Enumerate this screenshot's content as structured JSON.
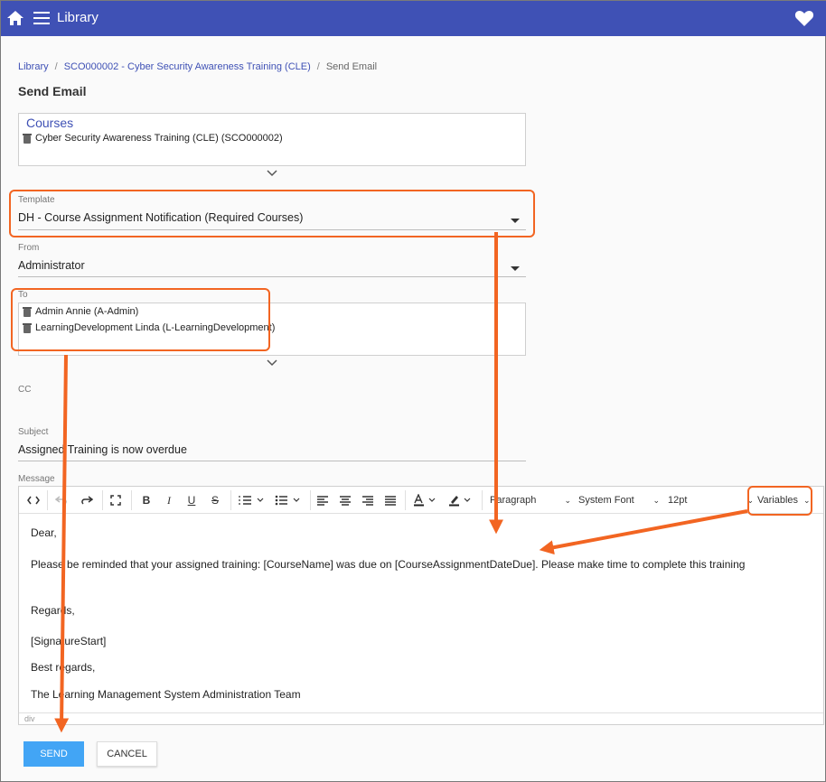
{
  "app": {
    "title": "Library"
  },
  "breadcrumb": [
    "Library",
    "SCO000002 - Cyber Security Awareness Training (CLE)",
    "Send Email"
  ],
  "page_title": "Send Email",
  "courses": {
    "label": "Courses",
    "items": [
      "Cyber Security Awareness Training (CLE) (SCO000002)"
    ]
  },
  "template": {
    "label": "Template",
    "value": "DH - Course Assignment Notification (Required Courses)"
  },
  "from": {
    "label": "From",
    "value": "Administrator"
  },
  "to": {
    "label": "To",
    "items": [
      "Admin Annie (A-Admin)",
      "LearningDevelopment Linda (L-LearningDevelopment)"
    ]
  },
  "cc": {
    "label": "CC"
  },
  "subject": {
    "label": "Subject",
    "value": "Assigned Training is now overdue"
  },
  "message": {
    "label": "Message",
    "toolbar": {
      "block_format": "Paragraph",
      "font_family": "System Font",
      "font_size": "12pt",
      "variables": "Variables"
    },
    "lines": [
      "Dear,",
      "Please be reminded that your assigned training: [CourseName] was due on [CourseAssignmentDateDue]. Please make time to complete this training",
      "Regards,",
      "[SignatureStart]",
      "Best regards,",
      "The Learning Management System Administration Team"
    ],
    "status_path": "div"
  },
  "actions": {
    "send": "SEND",
    "cancel": "CANCEL"
  },
  "colors": {
    "header": "#3f51b5",
    "accent": "#42a5f5",
    "annotation": "#f26522"
  }
}
